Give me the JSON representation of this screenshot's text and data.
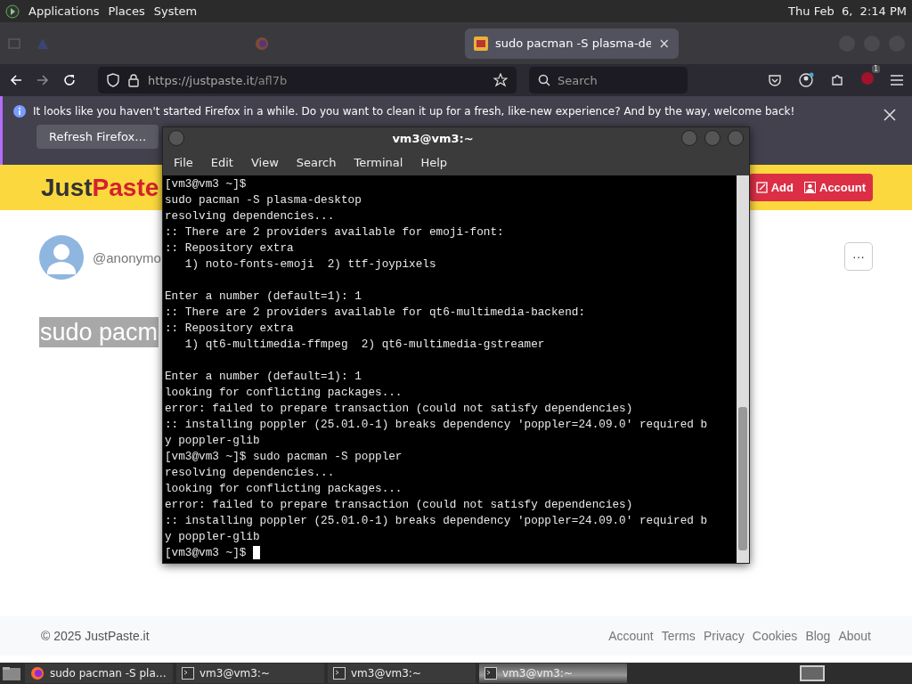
{
  "top_panel": {
    "menus": [
      "Applications",
      "Places",
      "System"
    ],
    "clock": "Thu Feb  6,  2:14 PM"
  },
  "browser": {
    "tabs": [
      {
        "kind": "site",
        "selected": false
      },
      {
        "kind": "firefox",
        "selected": false
      },
      {
        "kind": "jp",
        "label": "sudo pacman -S plasma-de",
        "selected": true
      }
    ],
    "tab_close": "×",
    "url": {
      "host": "https://justpaste.it",
      "path": "/afl7b"
    },
    "search": {
      "placeholder": "Search"
    },
    "extension_badge": "1",
    "notification": {
      "text": "It looks like you haven't started Firefox in a while. Do you want to clean it up for a fresh, like-new experience? And by the way, welcome back!",
      "button": "Refresh Firefox…"
    }
  },
  "page": {
    "logo": {
      "dark": "Just",
      "red": "Paste"
    },
    "header_buttons": [
      "Add",
      "Account"
    ],
    "author": "@anonymo",
    "title": "sudo pacm",
    "more": "···",
    "footer": {
      "copyright": "© 2025 JustPaste.it",
      "links": [
        "Account",
        "Terms",
        "Privacy",
        "Cookies",
        "Blog",
        "About"
      ]
    }
  },
  "terminal": {
    "title": "vm3@vm3:~",
    "menus": [
      "File",
      "Edit",
      "View",
      "Search",
      "Terminal",
      "Help"
    ],
    "lines": [
      {
        "kind": "text",
        "text": "[vm3@vm3 ~]$"
      },
      {
        "kind": "text",
        "text": "sudo pacman -S plasma-desktop"
      },
      {
        "kind": "text",
        "text": "resolving dependencies..."
      },
      {
        "kind": "text",
        "text": ":: There are 2 providers available for emoji-font:"
      },
      {
        "kind": "text",
        "text": ":: Repository extra"
      },
      {
        "kind": "text",
        "text": "   1) noto-fonts-emoji  2) ttf-joypixels"
      },
      {
        "kind": "blank"
      },
      {
        "kind": "text",
        "text": "Enter a number (default=1): 1"
      },
      {
        "kind": "text",
        "text": ":: There are 2 providers available for qt6-multimedia-backend:"
      },
      {
        "kind": "text",
        "text": ":: Repository extra"
      },
      {
        "kind": "text",
        "text": "   1) qt6-multimedia-ffmpeg  2) qt6-multimedia-gstreamer"
      },
      {
        "kind": "blank"
      },
      {
        "kind": "text",
        "text": "Enter a number (default=1): 1"
      },
      {
        "kind": "text",
        "text": "looking for conflicting packages..."
      },
      {
        "kind": "text",
        "text": "error: failed to prepare transaction (could not satisfy dependencies)"
      },
      {
        "kind": "text",
        "text": ":: installing poppler (25.01.0-1) breaks dependency 'poppler=24.09.0' required b"
      },
      {
        "kind": "text",
        "text": "y poppler-glib"
      },
      {
        "kind": "text",
        "text": "[vm3@vm3 ~]$ sudo pacman -S poppler"
      },
      {
        "kind": "text",
        "text": "resolving dependencies..."
      },
      {
        "kind": "text",
        "text": "looking for conflicting packages..."
      },
      {
        "kind": "text",
        "text": "error: failed to prepare transaction (could not satisfy dependencies)"
      },
      {
        "kind": "text",
        "text": ":: installing poppler (25.01.0-1) breaks dependency 'poppler=24.09.0' required b"
      },
      {
        "kind": "text",
        "text": "y poppler-glib"
      },
      {
        "kind": "text",
        "text": "[vm3@vm3 ~]$ "
      }
    ]
  },
  "taskbar": {
    "items": [
      {
        "kind": "firefox",
        "label": "sudo pacman -S pla…",
        "selected": false
      },
      {
        "kind": "terminal",
        "label": "vm3@vm3:~",
        "selected": false
      },
      {
        "kind": "terminal",
        "label": "vm3@vm3:~",
        "selected": false
      },
      {
        "kind": "terminal",
        "label": "vm3@vm3:~",
        "selected": true
      }
    ]
  }
}
